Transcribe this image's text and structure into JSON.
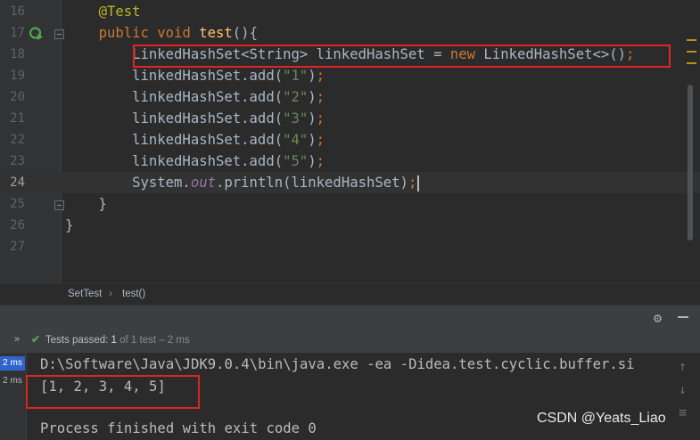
{
  "editor": {
    "lines": [
      {
        "num": "16",
        "tokens": [
          {
            "t": "    "
          },
          {
            "c": "ann",
            "t": "@Test"
          }
        ]
      },
      {
        "num": "17",
        "tokens": [
          {
            "t": "    "
          },
          {
            "c": "kw",
            "t": "public void "
          },
          {
            "c": "fn",
            "t": "test"
          },
          {
            "t": "(){"
          }
        ]
      },
      {
        "num": "18",
        "tokens": [
          {
            "t": "        LinkedHashSet<String> linkedHashSet = "
          },
          {
            "c": "kw",
            "t": "new "
          },
          {
            "t": "LinkedHashSet<>()"
          },
          {
            "c": "kw",
            "t": ";"
          }
        ]
      },
      {
        "num": "19",
        "tokens": [
          {
            "t": "        linkedHashSet.add("
          },
          {
            "c": "str",
            "t": "\"1\""
          },
          {
            "t": ")"
          },
          {
            "c": "kw",
            "t": ";"
          }
        ]
      },
      {
        "num": "20",
        "tokens": [
          {
            "t": "        linkedHashSet.add("
          },
          {
            "c": "str",
            "t": "\"2\""
          },
          {
            "t": ")"
          },
          {
            "c": "kw",
            "t": ";"
          }
        ]
      },
      {
        "num": "21",
        "tokens": [
          {
            "t": "        linkedHashSet.add("
          },
          {
            "c": "str",
            "t": "\"3\""
          },
          {
            "t": ")"
          },
          {
            "c": "kw",
            "t": ";"
          }
        ]
      },
      {
        "num": "22",
        "tokens": [
          {
            "t": "        linkedHashSet.add("
          },
          {
            "c": "str",
            "t": "\"4\""
          },
          {
            "t": ")"
          },
          {
            "c": "kw",
            "t": ";"
          }
        ]
      },
      {
        "num": "23",
        "tokens": [
          {
            "t": "        linkedHashSet.add("
          },
          {
            "c": "str",
            "t": "\"5\""
          },
          {
            "t": ")"
          },
          {
            "c": "kw",
            "t": ";"
          }
        ]
      },
      {
        "num": "24",
        "current": true,
        "caret": true,
        "tokens": [
          {
            "t": "        System."
          },
          {
            "c": "it",
            "t": "out"
          },
          {
            "t": ".println(linkedHashSet)"
          },
          {
            "c": "kw",
            "t": ";"
          }
        ]
      },
      {
        "num": "25",
        "tokens": [
          {
            "t": "    }"
          }
        ]
      },
      {
        "num": "26",
        "tokens": [
          {
            "t": "}"
          }
        ]
      },
      {
        "num": "27",
        "tokens": []
      }
    ]
  },
  "breadcrumb": {
    "class_name": "SetTest",
    "separator": "›",
    "method": "test()"
  },
  "toolbar": {
    "gear_icon": "⚙"
  },
  "status": {
    "expand_icon": "»",
    "check_icon": "✔",
    "label": "Tests passed:",
    "count": "1",
    "suffix": "of 1 test – 2 ms"
  },
  "console": {
    "times": [
      "2 ms",
      "2 ms"
    ],
    "lines": [
      "D:\\Software\\Java\\JDK9.0.4\\bin\\java.exe -ea -Didea.test.cyclic.buffer.si",
      "[1, 2, 3, 4, 5]",
      "",
      "Process finished with exit code 0"
    ],
    "up_icon": "↑",
    "down_icon": "↓",
    "wrap_icon": "≡"
  },
  "watermark": "CSDN @Yeats_Liao",
  "colors": {
    "highlight_box": "#e02323",
    "selected_time": "#2f65ca",
    "check": "#4fa94f"
  }
}
